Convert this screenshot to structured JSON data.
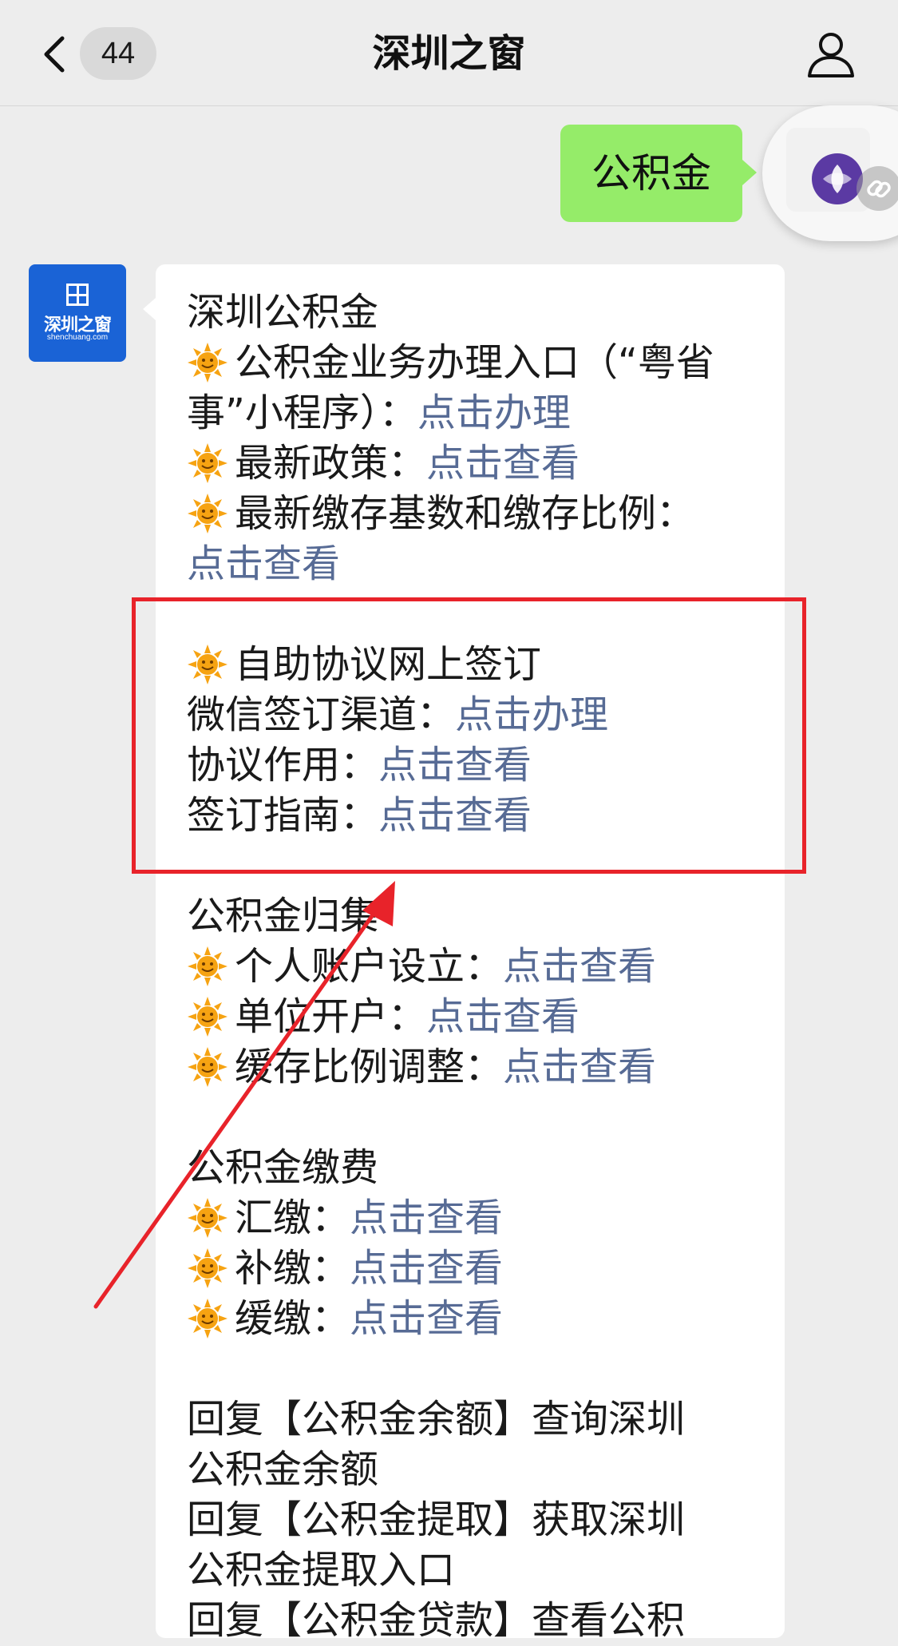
{
  "navbar": {
    "back_icon": "chevron-left-icon",
    "unread_count": "44",
    "title": "深圳之窗",
    "profile_icon": "person-icon"
  },
  "outgoing": {
    "text": "公积金"
  },
  "float_ball": {
    "icon": "link-icon"
  },
  "official_account": {
    "avatar_name": "深圳之窗",
    "avatar_url": "shenchuang.com"
  },
  "message": {
    "heading": "深圳公积金",
    "item1_prefix": "公积金业务办理入口（“粤省",
    "item1_cont": "事”小程序）：",
    "item1_link": "点击办理",
    "item2_prefix": "最新政策：",
    "item2_link": "点击查看",
    "item3_prefix": "最新缴存基数和缴存比例：",
    "item3_link": "点击查看",
    "sign_title": "自助协议网上签订",
    "sign_channel_prefix": "微信签订渠道：",
    "sign_channel_link": "点击办理",
    "sign_use_prefix": "协议作用：",
    "sign_use_link": "点击查看",
    "sign_guide_prefix": "签订指南：",
    "sign_guide_link": "点击查看",
    "collect_heading": "公积金归集",
    "collect_1_prefix": "个人账户设立：",
    "collect_1_link": "点击查看",
    "collect_2_prefix": "单位开户：",
    "collect_2_link": "点击查看",
    "collect_3_prefix": "缓存比例调整：",
    "collect_3_link": "点击查看",
    "pay_heading": "公积金缴费",
    "pay_1_prefix": "汇缴：",
    "pay_1_link": "点击查看",
    "pay_2_prefix": "补缴：",
    "pay_2_link": "点击查看",
    "pay_3_prefix": "缓缴：",
    "pay_3_link": "点击查看",
    "reply_1a": "回复【公积金余额】查询深圳",
    "reply_1b": "公积金余额",
    "reply_2a": "回复【公积金提取】获取深圳",
    "reply_2b": "公积金提取入口",
    "reply_3a": "回复【公积金贷款】查看公积"
  },
  "bullet_icon": "sun-emoji-icon",
  "colors": {
    "link": "#576b95",
    "outgoing_bubble": "#95ec69",
    "annotation": "#e8232a",
    "avatar": "#1a63d6"
  }
}
